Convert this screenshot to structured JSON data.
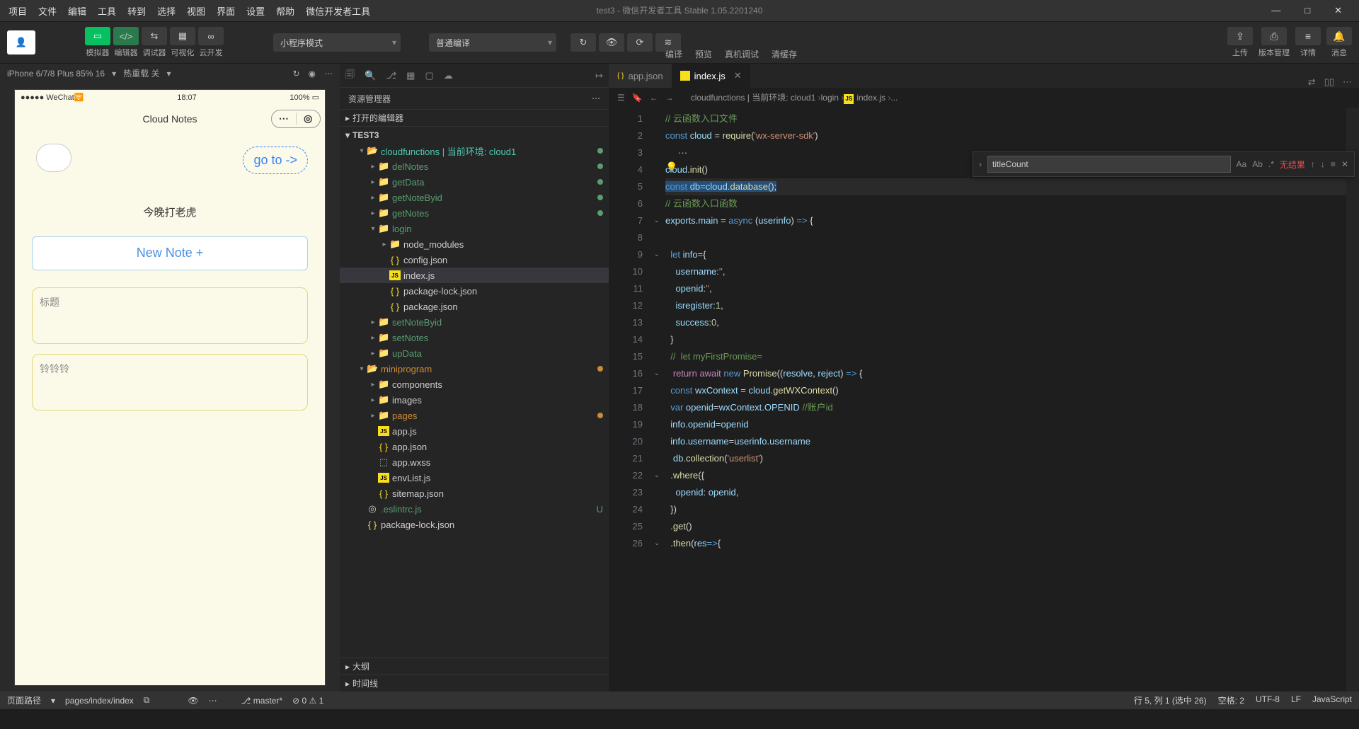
{
  "menu": [
    "项目",
    "文件",
    "编辑",
    "工具",
    "转到",
    "选择",
    "视图",
    "界面",
    "设置",
    "帮助",
    "微信开发者工具"
  ],
  "title": "test3 - 微信开发者工具 Stable 1.05.2201240",
  "toolbar": {
    "modes": [
      "模拟器",
      "编辑器",
      "调试器",
      "可视化",
      "云开发"
    ],
    "drop1": "小程序模式",
    "drop2": "普通编译",
    "actions": [
      "编译",
      "预览",
      "真机调试",
      "清缓存"
    ],
    "right": [
      "上传",
      "版本管理",
      "详情",
      "消息"
    ]
  },
  "device": {
    "name": "iPhone 6/7/8 Plus 85% 16",
    "reload": "热重载 关"
  },
  "phone": {
    "carrier": "WeChat",
    "time": "18:07",
    "battery": "100%",
    "title": "Cloud Notes",
    "goto": "go to ->",
    "slogan": "今晚打老虎",
    "newnote": "New Note +",
    "cards": [
      "标题",
      "铃铃铃"
    ]
  },
  "explorer": {
    "title": "资源管理器",
    "opened": "打开的编辑器",
    "root": "TEST3",
    "tree": [
      {
        "d": 1,
        "chev": "▾",
        "ic": "folder-open",
        "lbl": "cloudfunctions | 当前环境: cloud1",
        "cls": "b",
        "dot": "gr"
      },
      {
        "d": 2,
        "chev": "▸",
        "ic": "func",
        "lbl": "delNotes",
        "cls": "g",
        "dot": "gr"
      },
      {
        "d": 2,
        "chev": "▸",
        "ic": "func",
        "lbl": "getData",
        "cls": "g",
        "dot": "gr"
      },
      {
        "d": 2,
        "chev": "▸",
        "ic": "func",
        "lbl": "getNoteByid",
        "cls": "g",
        "dot": "gr"
      },
      {
        "d": 2,
        "chev": "▸",
        "ic": "func",
        "lbl": "getNotes",
        "cls": "g",
        "dot": "gr"
      },
      {
        "d": 2,
        "chev": "▾",
        "ic": "func",
        "lbl": "login",
        "cls": "g",
        "dot": ""
      },
      {
        "d": 3,
        "chev": "▸",
        "ic": "folder",
        "lbl": "node_modules",
        "cls": "",
        "dot": ""
      },
      {
        "d": 3,
        "chev": "",
        "ic": "json",
        "lbl": "config.json",
        "cls": "",
        "dot": ""
      },
      {
        "d": 3,
        "chev": "",
        "ic": "js",
        "lbl": "index.js",
        "cls": "",
        "dot": "",
        "sel": true
      },
      {
        "d": 3,
        "chev": "",
        "ic": "json",
        "lbl": "package-lock.json",
        "cls": "",
        "dot": ""
      },
      {
        "d": 3,
        "chev": "",
        "ic": "json",
        "lbl": "package.json",
        "cls": "",
        "dot": ""
      },
      {
        "d": 2,
        "chev": "▸",
        "ic": "func",
        "lbl": "setNoteByid",
        "cls": "g",
        "dot": ""
      },
      {
        "d": 2,
        "chev": "▸",
        "ic": "func",
        "lbl": "setNotes",
        "cls": "g",
        "dot": ""
      },
      {
        "d": 2,
        "chev": "▸",
        "ic": "func",
        "lbl": "upData",
        "cls": "g",
        "dot": ""
      },
      {
        "d": 1,
        "chev": "▾",
        "ic": "folder-open",
        "lbl": "miniprogram",
        "cls": "o",
        "dot": "or"
      },
      {
        "d": 2,
        "chev": "▸",
        "ic": "folder",
        "lbl": "components",
        "cls": "",
        "dot": ""
      },
      {
        "d": 2,
        "chev": "▸",
        "ic": "folder",
        "lbl": "images",
        "cls": "",
        "dot": ""
      },
      {
        "d": 2,
        "chev": "▸",
        "ic": "pfolder",
        "lbl": "pages",
        "cls": "o",
        "dot": "or"
      },
      {
        "d": 2,
        "chev": "",
        "ic": "js",
        "lbl": "app.js",
        "cls": "",
        "dot": ""
      },
      {
        "d": 2,
        "chev": "",
        "ic": "json",
        "lbl": "app.json",
        "cls": "",
        "dot": ""
      },
      {
        "d": 2,
        "chev": "",
        "ic": "css",
        "lbl": "app.wxss",
        "cls": "",
        "dot": ""
      },
      {
        "d": 2,
        "chev": "",
        "ic": "js",
        "lbl": "envList.js",
        "cls": "",
        "dot": ""
      },
      {
        "d": 2,
        "chev": "",
        "ic": "json",
        "lbl": "sitemap.json",
        "cls": "",
        "dot": ""
      },
      {
        "d": 1,
        "chev": "",
        "ic": "eslint",
        "lbl": ".eslintrc.js",
        "cls": "g",
        "dot": "",
        "badge": "U"
      },
      {
        "d": 1,
        "chev": "",
        "ic": "json",
        "lbl": "package-lock.json",
        "cls": "",
        "dot": ""
      }
    ],
    "sections": [
      "大纲",
      "时间线"
    ]
  },
  "tabs": [
    {
      "ic": "json",
      "lbl": "app.json",
      "act": false
    },
    {
      "ic": "js",
      "lbl": "index.js",
      "act": true
    }
  ],
  "crumb": [
    "cloudfunctions | 当前环境: cloud1",
    "login",
    "index.js",
    "..."
  ],
  "find": {
    "value": "titleCount",
    "noresult": "无结果"
  },
  "code": [
    {
      "n": 1,
      "fold": "",
      "html": "<span class='c-com'>// 云函数入口文件</span>"
    },
    {
      "n": 2,
      "fold": "",
      "html": "<span class='c-kw'>const</span> <span class='c-var'>cloud</span> = <span class='c-fn'>require</span>(<span class='c-str'>'wx-server-sdk'</span>)"
    },
    {
      "n": 3,
      "fold": "",
      "html": "<span class='c-op'>     ···</span>"
    },
    {
      "n": 4,
      "fold": "",
      "html": "<span class='c-var'>cloud</span>.<span class='c-fn'>init</span>()"
    },
    {
      "n": 5,
      "fold": "",
      "hl": true,
      "html": "<span class='sel'><span class='c-kw'>const</span> <span class='c-var'>db</span>=<span class='c-var'>cloud</span>.<span class='c-fn'>database</span>();</span>"
    },
    {
      "n": 6,
      "fold": "",
      "html": "<span class='c-com'>// 云函数入口函数</span>"
    },
    {
      "n": 7,
      "fold": "⌄",
      "html": "<span class='c-var'>exports</span>.<span class='c-var'>main</span> = <span class='c-kw'>async</span> (<span class='c-var'>userinfo</span>) <span class='c-kw'>=&gt;</span> {"
    },
    {
      "n": 8,
      "fold": "",
      "html": ""
    },
    {
      "n": 9,
      "fold": "⌄",
      "html": "  <span class='c-kw'>let</span> <span class='c-var'>info</span>={"
    },
    {
      "n": 10,
      "fold": "",
      "html": "    <span class='c-var'>username</span>:<span class='c-str'>''</span>,"
    },
    {
      "n": 11,
      "fold": "",
      "html": "    <span class='c-var'>openid</span>:<span class='c-str'>''</span>,"
    },
    {
      "n": 12,
      "fold": "",
      "html": "    <span class='c-var'>isregister</span>:<span class='c-num'>1</span>,"
    },
    {
      "n": 13,
      "fold": "",
      "html": "    <span class='c-var'>success</span>:<span class='c-num'>0</span>,"
    },
    {
      "n": 14,
      "fold": "",
      "html": "  }"
    },
    {
      "n": 15,
      "fold": "",
      "html": "  <span class='c-com'>//  let myFirstPromise=</span>"
    },
    {
      "n": 16,
      "fold": "⌄",
      "html": "   <span class='c-kw2'>return</span> <span class='c-kw2'>await</span> <span class='c-kw'>new</span> <span class='c-fn'>Promise</span>((<span class='c-var'>resolve</span>, <span class='c-var'>reject</span>) <span class='c-kw'>=&gt;</span> {"
    },
    {
      "n": 17,
      "fold": "",
      "html": "  <span class='c-kw'>const</span> <span class='c-var'>wxContext</span> = <span class='c-var'>cloud</span>.<span class='c-fn'>getWXContext</span>()"
    },
    {
      "n": 18,
      "fold": "",
      "html": "  <span class='c-kw'>var</span> <span class='c-var'>openid</span>=<span class='c-var'>wxContext</span>.<span class='c-var'>OPENID</span> <span class='c-com'>//账户id</span>"
    },
    {
      "n": 19,
      "fold": "",
      "html": "  <span class='c-var'>info</span>.<span class='c-var'>openid</span>=<span class='c-var'>openid</span>"
    },
    {
      "n": 20,
      "fold": "",
      "html": "  <span class='c-var'>info</span>.<span class='c-var'>username</span>=<span class='c-var'>userinfo</span>.<span class='c-var'>username</span>"
    },
    {
      "n": 21,
      "fold": "",
      "html": "   <span class='c-var'>db</span>.<span class='c-fn'>collection</span>(<span class='c-str'>'userlist'</span>)"
    },
    {
      "n": 22,
      "fold": "⌄",
      "html": "  .<span class='c-fn'>where</span>({"
    },
    {
      "n": 23,
      "fold": "",
      "html": "    <span class='c-var'>openid</span>: <span class='c-var'>openid</span>,"
    },
    {
      "n": 24,
      "fold": "",
      "html": "  })"
    },
    {
      "n": 25,
      "fold": "",
      "html": "  .<span class='c-fn'>get</span>()"
    },
    {
      "n": 26,
      "fold": "⌄",
      "html": "  .<span class='c-fn'>then</span>(<span class='c-var'>res</span><span class='c-kw'>=&gt;</span>{"
    }
  ],
  "status": {
    "left": [
      "页面路径",
      "pages/index/index"
    ],
    "git": "master*",
    "errs": "⊘ 0 ⚠ 1",
    "right": [
      "行 5, 列 1 (选中 26)",
      "空格: 2",
      "UTF-8",
      "LF",
      "JavaScript"
    ]
  }
}
